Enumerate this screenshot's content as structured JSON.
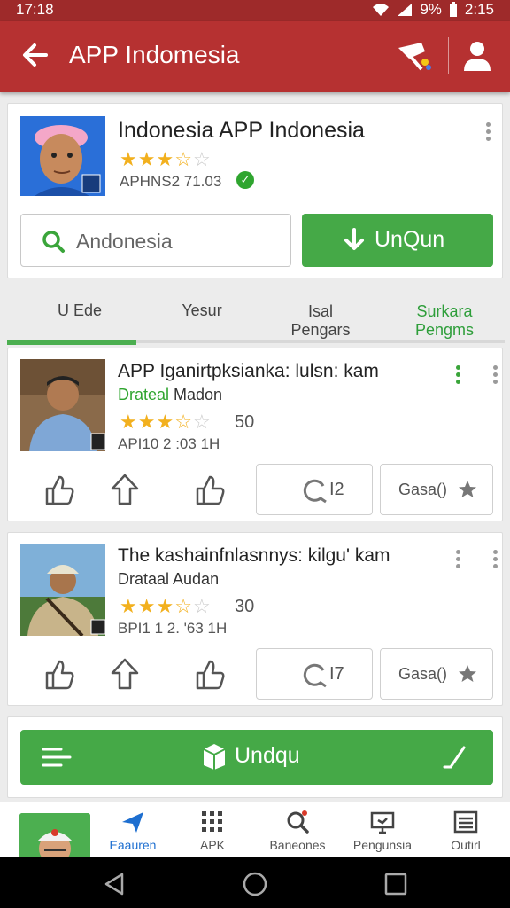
{
  "status_bar": {
    "time_left": "17:18",
    "battery": "9%",
    "time_right": "2:15"
  },
  "app_bar": {
    "title": "APP Indomesia"
  },
  "app_header": {
    "title": "Indonesia APP Indonesia",
    "rating": 3.5,
    "version": "APHNS2 71.03",
    "search": {
      "value": "Andonesia"
    },
    "download_label": "UnQun"
  },
  "tabs": [
    {
      "label": "U  Ede",
      "active": false
    },
    {
      "label": "Yesur",
      "active": false
    },
    {
      "label": "Isal\nPengars",
      "active": false
    },
    {
      "label": "Surkara\nPengms",
      "active": true
    }
  ],
  "posts": [
    {
      "title": "APP Iganirtpksianka: lulsn: kam",
      "author_highlight": "Drateal",
      "author_rest": " Madon",
      "rating": 3.5,
      "rating_count": "50",
      "date": "API10  2 :03 1H",
      "comment_count": "I2",
      "save_label": "Gasa()"
    },
    {
      "title": "The kashainfnlasnnys: kilgu' kam",
      "author_highlight": "",
      "author_rest": "Drataal Audan",
      "rating": 3.5,
      "rating_count": "30",
      "date": "BPI1 1  2. '63 1H",
      "comment_count": "I7",
      "save_label": "Gasa()"
    }
  ],
  "bottom_action": {
    "label": "Undqu"
  },
  "bottom_nav": [
    {
      "label": "Eaauren",
      "icon": "send-icon",
      "active": true
    },
    {
      "label": "APK",
      "icon": "grid-icon",
      "active": false
    },
    {
      "label": "Baneones",
      "icon": "search-icon",
      "active": false
    },
    {
      "label": "Pengunsia",
      "icon": "monitor-icon",
      "active": false
    },
    {
      "label": "Outirl",
      "icon": "list-icon",
      "active": false
    }
  ],
  "colors": {
    "app_bar": "#b63131",
    "accent_green": "#45a947",
    "star": "#f2b01e",
    "nav_active": "#1e6fd0"
  }
}
